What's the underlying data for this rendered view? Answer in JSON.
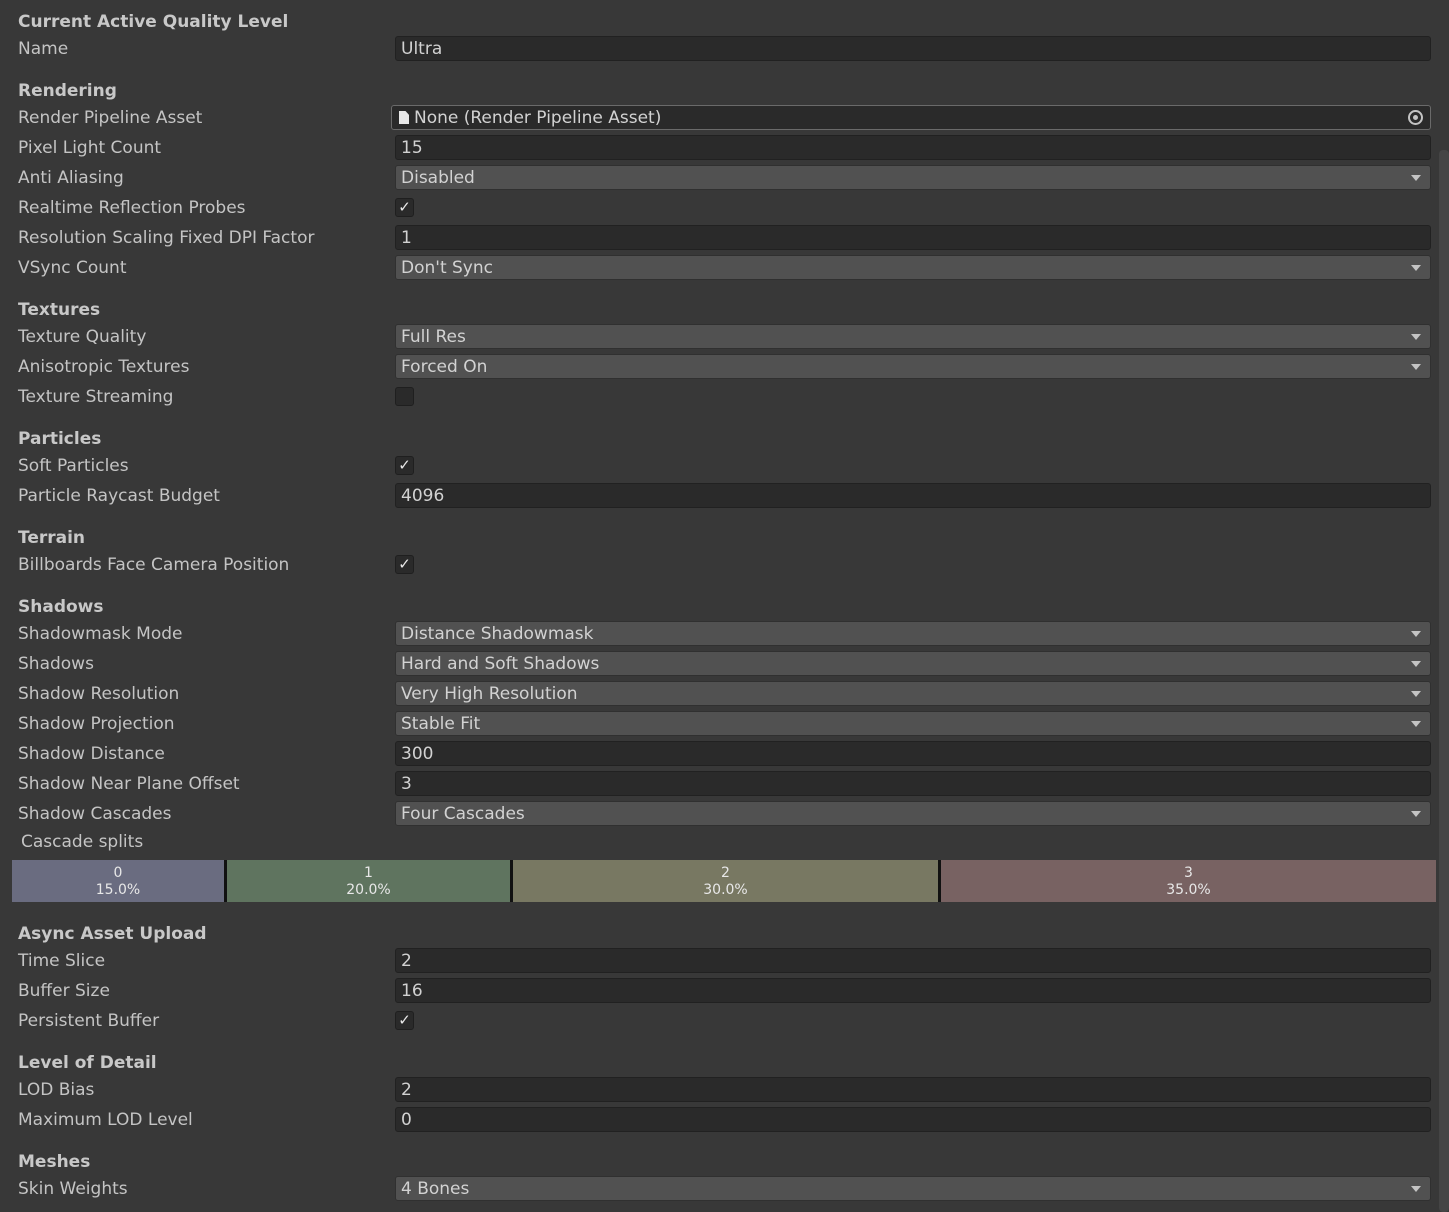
{
  "sections": {
    "current": "Current Active Quality Level",
    "rendering": "Rendering",
    "textures": "Textures",
    "particles": "Particles",
    "terrain": "Terrain",
    "shadows": "Shadows",
    "async": "Async Asset Upload",
    "lod": "Level of Detail",
    "meshes": "Meshes"
  },
  "labels": {
    "name": "Name",
    "render_pipeline_asset": "Render Pipeline Asset",
    "pixel_light_count": "Pixel Light Count",
    "anti_aliasing": "Anti Aliasing",
    "realtime_reflection_probes": "Realtime Reflection Probes",
    "resolution_scaling": "Resolution Scaling Fixed DPI Factor",
    "vsync_count": "VSync Count",
    "texture_quality": "Texture Quality",
    "anisotropic_textures": "Anisotropic Textures",
    "texture_streaming": "Texture Streaming",
    "soft_particles": "Soft Particles",
    "particle_raycast_budget": "Particle Raycast Budget",
    "billboards_face_camera": "Billboards Face Camera Position",
    "shadowmask_mode": "Shadowmask Mode",
    "shadows": "Shadows",
    "shadow_resolution": "Shadow Resolution",
    "shadow_projection": "Shadow Projection",
    "shadow_distance": "Shadow Distance",
    "shadow_near_plane_offset": "Shadow Near Plane Offset",
    "shadow_cascades": "Shadow Cascades",
    "cascade_splits": "Cascade splits",
    "time_slice": "Time Slice",
    "buffer_size": "Buffer Size",
    "persistent_buffer": "Persistent Buffer",
    "lod_bias": "LOD Bias",
    "maximum_lod_level": "Maximum LOD Level",
    "skin_weights": "Skin Weights"
  },
  "values": {
    "name": "Ultra",
    "render_pipeline_asset": "None (Render Pipeline Asset)",
    "pixel_light_count": "15",
    "anti_aliasing": "Disabled",
    "realtime_reflection_probes": true,
    "resolution_scaling": "1",
    "vsync_count": "Don't Sync",
    "texture_quality": "Full Res",
    "anisotropic_textures": "Forced On",
    "texture_streaming": false,
    "soft_particles": true,
    "particle_raycast_budget": "4096",
    "billboards_face_camera": true,
    "shadowmask_mode": "Distance Shadowmask",
    "shadows": "Hard and Soft Shadows",
    "shadow_resolution": "Very High Resolution",
    "shadow_projection": "Stable Fit",
    "shadow_distance": "300",
    "shadow_near_plane_offset": "3",
    "shadow_cascades": "Four Cascades",
    "time_slice": "2",
    "buffer_size": "16",
    "persistent_buffer": true,
    "lod_bias": "2",
    "maximum_lod_level": "0",
    "skin_weights": "4 Bones"
  },
  "check_glyph": "✓",
  "cascades": [
    {
      "index": "0",
      "percent": "15.0%",
      "fraction": 0.15,
      "color": "#6a6c80"
    },
    {
      "index": "1",
      "percent": "20.0%",
      "fraction": 0.2,
      "color": "#5f745f"
    },
    {
      "index": "2",
      "percent": "30.0%",
      "fraction": 0.3,
      "color": "#787862"
    },
    {
      "index": "3",
      "percent": "35.0%",
      "fraction": 0.35,
      "color": "#786262"
    }
  ],
  "icons": {
    "object": "doc-icon",
    "picker": "object-picker-icon",
    "dropdown": "chevron-down-icon",
    "checkbox": "checkmark-icon"
  }
}
